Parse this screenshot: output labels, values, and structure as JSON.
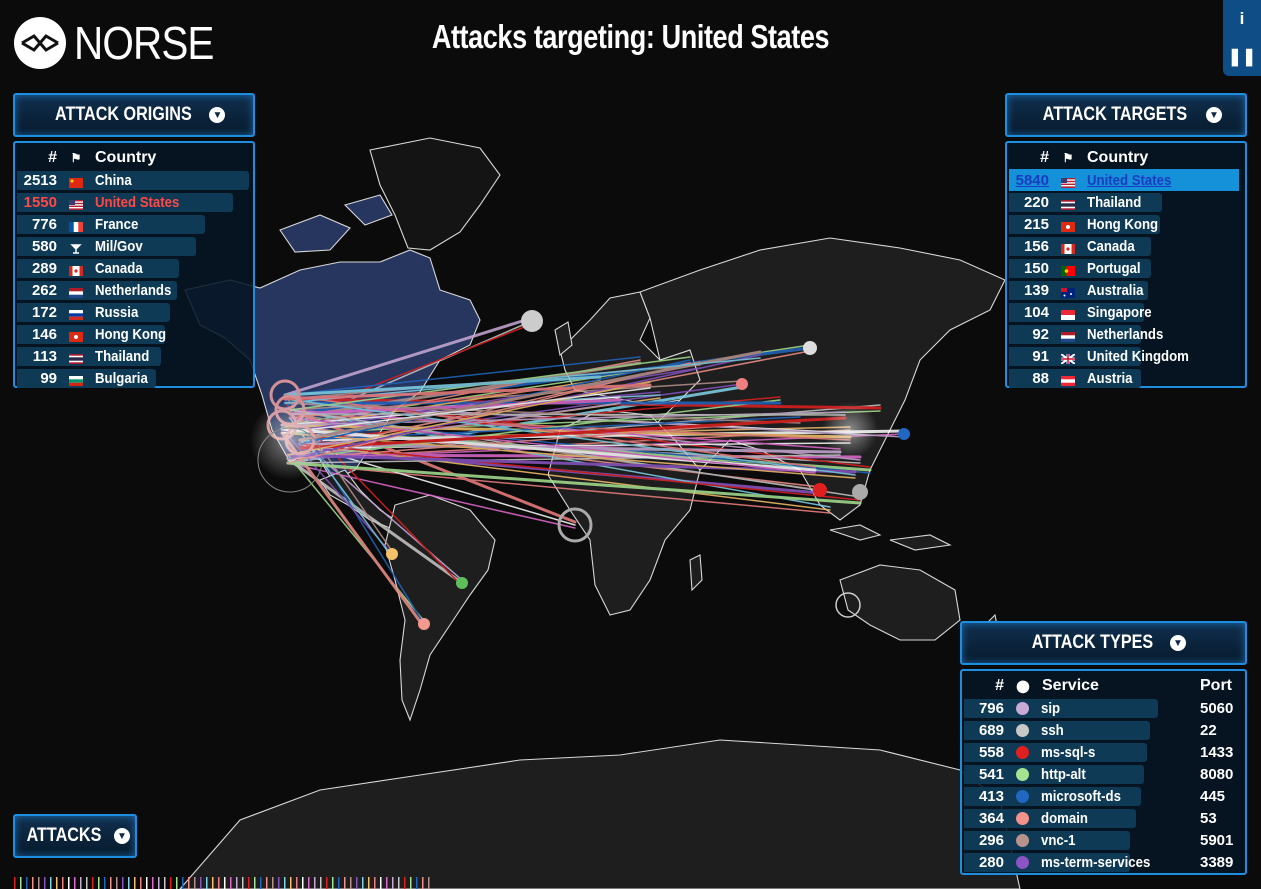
{
  "header": {
    "brand": "NORSE",
    "title": "Attacks targeting: United States",
    "info_icon": "i",
    "pause_icon": "❚❚"
  },
  "origins": {
    "title": "ATTACK ORIGINS",
    "columns": {
      "num": "#",
      "country": "Country"
    },
    "rows": [
      {
        "count": "2513",
        "country": "China",
        "flag": "cn",
        "frac": 1.0
      },
      {
        "count": "1550",
        "country": "United States",
        "flag": "us",
        "frac": 0.93,
        "highlight": true
      },
      {
        "count": "776",
        "country": "France",
        "flag": "fr",
        "frac": 0.81
      },
      {
        "count": "580",
        "country": "Mil/Gov",
        "flag": "mil",
        "frac": 0.77
      },
      {
        "count": "289",
        "country": "Canada",
        "flag": "ca",
        "frac": 0.7
      },
      {
        "count": "262",
        "country": "Netherlands",
        "flag": "nl",
        "frac": 0.69
      },
      {
        "count": "172",
        "country": "Russia",
        "flag": "ru",
        "frac": 0.66
      },
      {
        "count": "146",
        "country": "Hong Kong",
        "flag": "hk",
        "frac": 0.64
      },
      {
        "count": "113",
        "country": "Thailand",
        "flag": "th",
        "frac": 0.62
      },
      {
        "count": "99",
        "country": "Bulgaria",
        "flag": "bg",
        "frac": 0.6
      }
    ]
  },
  "targets": {
    "title": "ATTACK TARGETS",
    "columns": {
      "num": "#",
      "country": "Country"
    },
    "rows": [
      {
        "count": "5840",
        "country": "United States",
        "flag": "us",
        "frac": 1.0,
        "selected": true
      },
      {
        "count": "220",
        "country": "Thailand",
        "flag": "th",
        "frac": 0.66
      },
      {
        "count": "215",
        "country": "Hong Kong",
        "flag": "hk",
        "frac": 0.65
      },
      {
        "count": "156",
        "country": "Canada",
        "flag": "ca",
        "frac": 0.61
      },
      {
        "count": "150",
        "country": "Portugal",
        "flag": "pt",
        "frac": 0.61
      },
      {
        "count": "139",
        "country": "Australia",
        "flag": "au",
        "frac": 0.6
      },
      {
        "count": "104",
        "country": "Singapore",
        "flag": "sg",
        "frac": 0.58
      },
      {
        "count": "92",
        "country": "Netherlands",
        "flag": "nl",
        "frac": 0.57
      },
      {
        "count": "91",
        "country": "United Kingdom",
        "flag": "gb",
        "frac": 0.57
      },
      {
        "count": "88",
        "country": "Austria",
        "flag": "at",
        "frac": 0.57
      }
    ]
  },
  "types": {
    "title": "ATTACK TYPES",
    "columns": {
      "num": "#",
      "service": "Service",
      "port": "Port"
    },
    "rows": [
      {
        "count": "796",
        "service": "sip",
        "port": "5060",
        "color": "#c9a9d6",
        "frac": 0.7
      },
      {
        "count": "689",
        "service": "ssh",
        "port": "22",
        "color": "#c8c8c8",
        "frac": 0.67
      },
      {
        "count": "558",
        "service": "ms-sql-s",
        "port": "1433",
        "color": "#e0201e",
        "frac": 0.66
      },
      {
        "count": "541",
        "service": "http-alt",
        "port": "8080",
        "color": "#a6e391",
        "frac": 0.65
      },
      {
        "count": "413",
        "service": "microsoft-ds",
        "port": "445",
        "color": "#2166c0",
        "frac": 0.64
      },
      {
        "count": "364",
        "service": "domain",
        "port": "53",
        "color": "#f2928a",
        "frac": 0.62
      },
      {
        "count": "296",
        "service": "vnc-1",
        "port": "5901",
        "color": "#b8938c",
        "frac": 0.6
      },
      {
        "count": "280",
        "service": "ms-term-services",
        "port": "3389",
        "color": "#8a54c4",
        "frac": 0.6
      }
    ]
  },
  "attacks": {
    "title": "ATTACKS"
  },
  "colors": {
    "panel_border": "#1d8ee0",
    "highlight": "#ff4848",
    "selected_bg": "#1491d9"
  }
}
